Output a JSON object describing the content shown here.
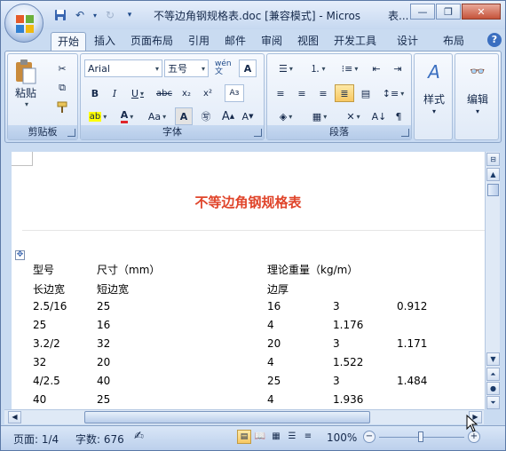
{
  "window": {
    "title": "不等边角钢规格表.doc [兼容模式] - Micros",
    "title_right": "表..."
  },
  "tabs": [
    "开始",
    "插入",
    "页面布局",
    "引用",
    "邮件",
    "审阅",
    "视图",
    "开发工具",
    "设计",
    "布局"
  ],
  "ribbon": {
    "clipboard": {
      "label": "剪贴板",
      "paste": "粘贴"
    },
    "font": {
      "label": "字体",
      "font_name": "Arial",
      "font_size": "五号",
      "wen": "wén 文",
      "a_box": "A"
    },
    "paragraph": {
      "label": "段落"
    },
    "styles": {
      "label": "样式"
    },
    "editing": {
      "label": "编辑"
    }
  },
  "document": {
    "heading": "不等边角钢规格表",
    "header_row1": [
      "型号",
      "尺寸（mm）",
      "理论重量（kg/m）"
    ],
    "header_row2": [
      "长边宽",
      "短边宽",
      "边厚"
    ],
    "rows": [
      [
        "2.5/16",
        "25",
        "16",
        "3",
        "0.912"
      ],
      [
        "25",
        "16",
        "4",
        "1.176",
        ""
      ],
      [
        "3.2/2",
        "32",
        "20",
        "3",
        "1.171"
      ],
      [
        "32",
        "20",
        "4",
        "1.522",
        ""
      ],
      [
        "4/2.5",
        "40",
        "25",
        "3",
        "1.484"
      ],
      [
        "40",
        "25",
        "4",
        "1.936",
        ""
      ]
    ]
  },
  "status": {
    "page": "页面: 1/4",
    "words": "字数: 676",
    "zoom": "100%"
  },
  "colors": {
    "heading": "#e0452b",
    "ribbon": "#dbe7f7",
    "frame": "#c9dbf1"
  }
}
